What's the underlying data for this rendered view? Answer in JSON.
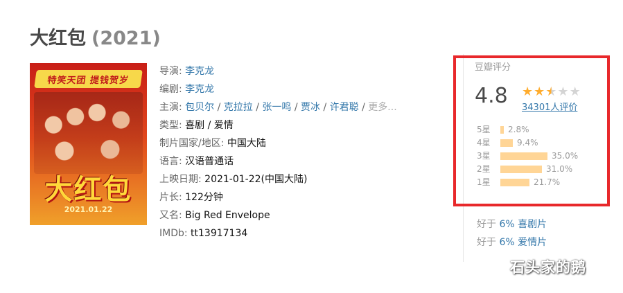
{
  "movie": {
    "title": "大红包",
    "year": "(2021)"
  },
  "poster": {
    "banner_text": "特笑天团 提钱贺岁",
    "title_text": "大红包",
    "date_text": "2021.01.22"
  },
  "info": {
    "director_label": "导演: ",
    "director": "李克龙",
    "writer_label": "编剧: ",
    "writer": "李克龙",
    "cast_label": "主演: ",
    "cast": [
      "包贝尔",
      "克拉拉",
      "张一鸣",
      "贾冰",
      "许君聪"
    ],
    "cast_more": "更多...",
    "separator": " / ",
    "genre_label": "类型: ",
    "genre": "喜剧 / 爱情",
    "country_label": "制片国家/地区: ",
    "country": "中国大陆",
    "language_label": "语言: ",
    "language": "汉语普通话",
    "release_label": "上映日期: ",
    "release": "2021-01-22(中国大陆)",
    "runtime_label": "片长: ",
    "runtime": "122分钟",
    "aka_label": "又名: ",
    "aka": "Big Red Envelope",
    "imdb_label": "IMDb: ",
    "imdb": "tt13917134"
  },
  "rating": {
    "label": "豆瓣评分",
    "score": "4.8",
    "stars_out_of_5": 2.5,
    "votes": "34301人评价",
    "distribution": [
      {
        "label": "5星",
        "percent": 2.8,
        "text": "2.8%"
      },
      {
        "label": "4星",
        "percent": 9.4,
        "text": "9.4%"
      },
      {
        "label": "3星",
        "percent": 35.0,
        "text": "35.0%"
      },
      {
        "label": "2星",
        "percent": 31.0,
        "text": "31.0%"
      },
      {
        "label": "1星",
        "percent": 21.7,
        "text": "21.7%"
      }
    ],
    "highlight_color": "#e8282b",
    "bar_color": "#ffd596",
    "star_color": "#ffac2d"
  },
  "better_than": [
    {
      "prefix": "好于 ",
      "link": "6% 喜剧片"
    },
    {
      "prefix": "好于 ",
      "link": "6% 爱情片"
    }
  ],
  "watermark": "石头家的鹅"
}
